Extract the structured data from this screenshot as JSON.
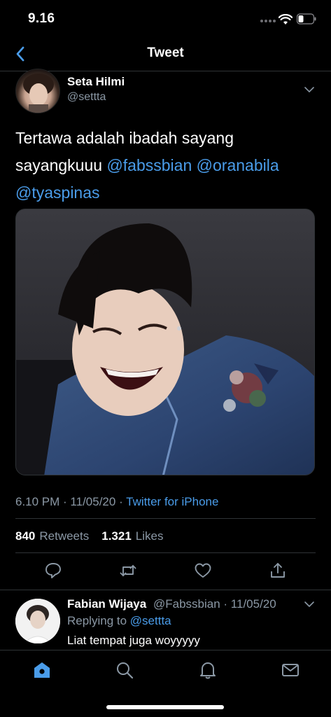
{
  "status": {
    "time": "9.16"
  },
  "nav": {
    "title": "Tweet"
  },
  "tweet": {
    "author_name": "Seta Hilmi",
    "author_handle": "@settta",
    "text_line1": "Tertawa adalah ibadah sayang",
    "text_line2_plain": "sayangkuuu ",
    "mention1": "@fabssbian",
    "mention2": "@oranabila",
    "mention3": "@tyaspinas",
    "time": "6.10 PM",
    "date": "11/05/20",
    "source": "Twitter for iPhone",
    "retweets_count": "840",
    "retweets_label": "Retweets",
    "likes_count": "1.321",
    "likes_label": "Likes"
  },
  "actions": [
    {
      "icon": "reply-icon"
    },
    {
      "icon": "retweet-icon"
    },
    {
      "icon": "like-icon"
    },
    {
      "icon": "share-icon"
    }
  ],
  "reply": {
    "name": "Fabian Wijaya",
    "handle_time": "@Fabssbian · 11/05/20",
    "replying_label": "Replying to",
    "replying_to": "@settta",
    "text": "Liat tempat juga woyyyyy"
  },
  "tabs": [
    {
      "icon": "home-icon",
      "active": true
    },
    {
      "icon": "search-icon",
      "active": false
    },
    {
      "icon": "notifications-icon",
      "active": false
    },
    {
      "icon": "messages-icon",
      "active": false
    }
  ],
  "colors": {
    "accent": "#4a9ce9",
    "secondary_text": "#8b98a5",
    "background": "#000000",
    "divider": "#2f3336"
  }
}
